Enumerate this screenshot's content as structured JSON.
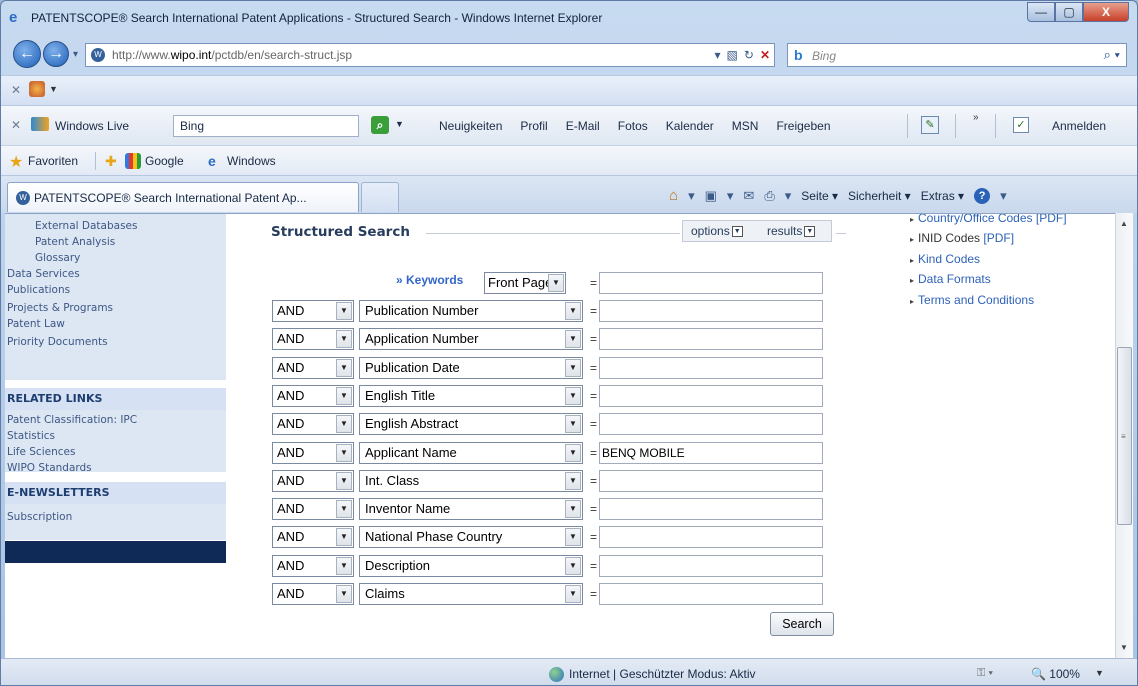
{
  "window": {
    "title": "PATENTSCOPE® Search International Patent Applications - Structured Search - Windows Internet Explorer",
    "btn_min": "—",
    "btn_max": "▢",
    "btn_close": "X"
  },
  "address": {
    "url_prefix": "http://www.",
    "url_host": "wipo.int",
    "url_path": "/pctdb/en/search-struct.jsp",
    "search_placeholder": "Bing"
  },
  "live_toolbar": {
    "brand": "Windows Live",
    "search_value": "Bing",
    "links": [
      "Neuigkeiten",
      "Profil",
      "E-Mail",
      "Fotos",
      "Kalender",
      "MSN",
      "Freigeben"
    ],
    "signin": "Anmelden"
  },
  "favorites": {
    "label": "Favoriten",
    "items": [
      "Google",
      "Windows"
    ]
  },
  "tab": {
    "title": "PATENTSCOPE® Search International Patent Ap..."
  },
  "command_bar": {
    "page": "Seite ▾",
    "safety": "Sicherheit ▾",
    "extras": "Extras ▾"
  },
  "left_nav": {
    "sub_items": [
      "External Databases",
      "Patent Analysis",
      "Glossary"
    ],
    "main_items": [
      "Data Services",
      "Publications",
      "Projects & Programs",
      "Patent Law",
      "Priority Documents"
    ],
    "related_heading": "RELATED LINKS",
    "related_items": [
      "Patent Classification: IPC",
      "Statistics",
      "Life Sciences",
      "WIPO Standards"
    ],
    "newsletters_heading": "E-NEWSLETTERS",
    "newsletters_items": [
      "Subscription"
    ]
  },
  "structured_search": {
    "title": "Structured Search",
    "options_label": "options",
    "results_label": "results",
    "keywords_label": "» Keywords",
    "keywords_scope": "Front Page",
    "equals": "=",
    "rows": [
      {
        "op": "AND",
        "field": "Publication Number",
        "value": ""
      },
      {
        "op": "AND",
        "field": "Application Number",
        "value": ""
      },
      {
        "op": "AND",
        "field": "Publication Date",
        "value": ""
      },
      {
        "op": "AND",
        "field": "English Title",
        "value": ""
      },
      {
        "op": "AND",
        "field": "English Abstract",
        "value": ""
      },
      {
        "op": "AND",
        "field": "Applicant Name",
        "value": "BENQ MOBILE"
      },
      {
        "op": "AND",
        "field": "Int. Class",
        "value": ""
      },
      {
        "op": "AND",
        "field": "Inventor Name",
        "value": ""
      },
      {
        "op": "AND",
        "field": "National Phase Country",
        "value": ""
      },
      {
        "op": "AND",
        "field": "Description",
        "value": ""
      },
      {
        "op": "AND",
        "field": "Claims",
        "value": ""
      }
    ],
    "search_button": "Search"
  },
  "right_links": {
    "items": [
      {
        "label": "Country/Office Codes",
        "suffix": "[PDF]"
      },
      {
        "label": "INID Codes",
        "suffix": "[PDF]"
      },
      {
        "label": "Kind Codes",
        "suffix": ""
      },
      {
        "label": "Data Formats",
        "suffix": ""
      },
      {
        "label": "Terms and Conditions",
        "suffix": ""
      }
    ]
  },
  "status": {
    "zone": "Internet | Geschützter Modus: Aktiv",
    "zoom": "100%"
  }
}
